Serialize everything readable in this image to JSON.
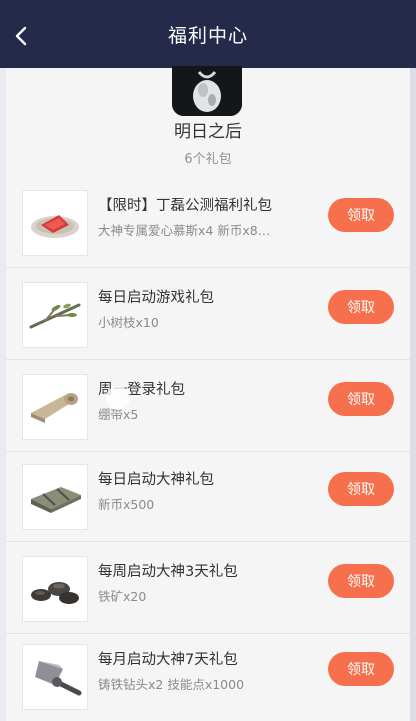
{
  "header": {
    "title": "福利中心",
    "back_icon": "chevron-left-icon"
  },
  "game": {
    "name": "明日之后",
    "pack_count": "6个礼包"
  },
  "packs": [
    {
      "title": "【限时】丁磊公测福利礼包",
      "desc": "大神专属爱心慕斯x4 新币x8…",
      "button": "领取",
      "icon": "food-icon"
    },
    {
      "title": "每日启动游戏礼包",
      "desc": "小树枝x10",
      "button": "领取",
      "icon": "twig-icon"
    },
    {
      "title": "周一登录礼包",
      "desc": "绷带x5",
      "button": "领取",
      "icon": "bandage-icon"
    },
    {
      "title": "每日启动大神礼包",
      "desc": "新币x500",
      "button": "领取",
      "icon": "coin-bundle-icon"
    },
    {
      "title": "每周启动大神3天礼包",
      "desc": "铁矿x20",
      "button": "领取",
      "icon": "ore-icon"
    },
    {
      "title": "每月启动大神7天礼包",
      "desc": "铸铁钻头x2 技能点x1000",
      "button": "领取",
      "icon": "drill-icon"
    }
  ],
  "colors": {
    "header_bg": "#252a4a",
    "button_bg": "#f6704e"
  }
}
